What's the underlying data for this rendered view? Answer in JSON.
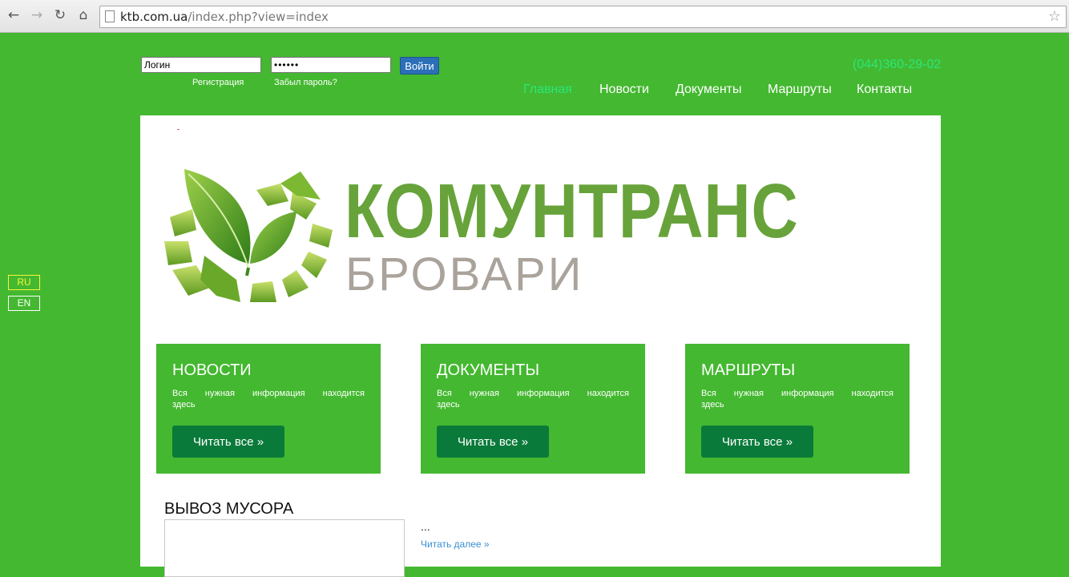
{
  "browser": {
    "url_domain": "ktb.com.ua",
    "url_path": "/index.php?view=index",
    "back_icon": "←",
    "forward_icon": "→",
    "reload_icon": "↻",
    "home_icon": "⌂",
    "star_icon": "☆"
  },
  "login": {
    "username_value": "Логин",
    "password_value": "••••••",
    "submit_label": "Войти",
    "register_link": "Регистрация",
    "forgot_link": "Забыл пароль?"
  },
  "header": {
    "phone": "(044)360-29-02",
    "menu": [
      {
        "label": "Главная",
        "active": true
      },
      {
        "label": "Новости",
        "active": false
      },
      {
        "label": "Документы",
        "active": false
      },
      {
        "label": "Маршруты",
        "active": false
      },
      {
        "label": "Контакты",
        "active": false
      }
    ]
  },
  "languages": [
    "RU",
    "EN"
  ],
  "logo": {
    "title": "КОМУНТРАНС",
    "subtitle": "БРОВАРИ"
  },
  "boxes": [
    {
      "title": "НОВОСТИ",
      "text_line1": "Вся нужная информация находится",
      "text_line2": "здесь",
      "button": "Читать все »"
    },
    {
      "title": "ДОКУМЕНТЫ",
      "text_line1": "Вся нужная информация находится",
      "text_line2": "здесь",
      "button": "Читать все »"
    },
    {
      "title": "МАРШРУТЫ",
      "text_line1": "Вся нужная информация находится",
      "text_line2": "здесь",
      "button": "Читать все »"
    }
  ],
  "article": {
    "title": "ВЫВОЗ МУСОРА",
    "excerpt": "...",
    "read_more": "Читать далее »"
  },
  "colors": {
    "page_bg": "#44b830",
    "accent_green": "#29e77b",
    "button_dark": "#0a7a3a",
    "logo_green": "#67a33a",
    "logo_grey": "#aaa39b"
  }
}
